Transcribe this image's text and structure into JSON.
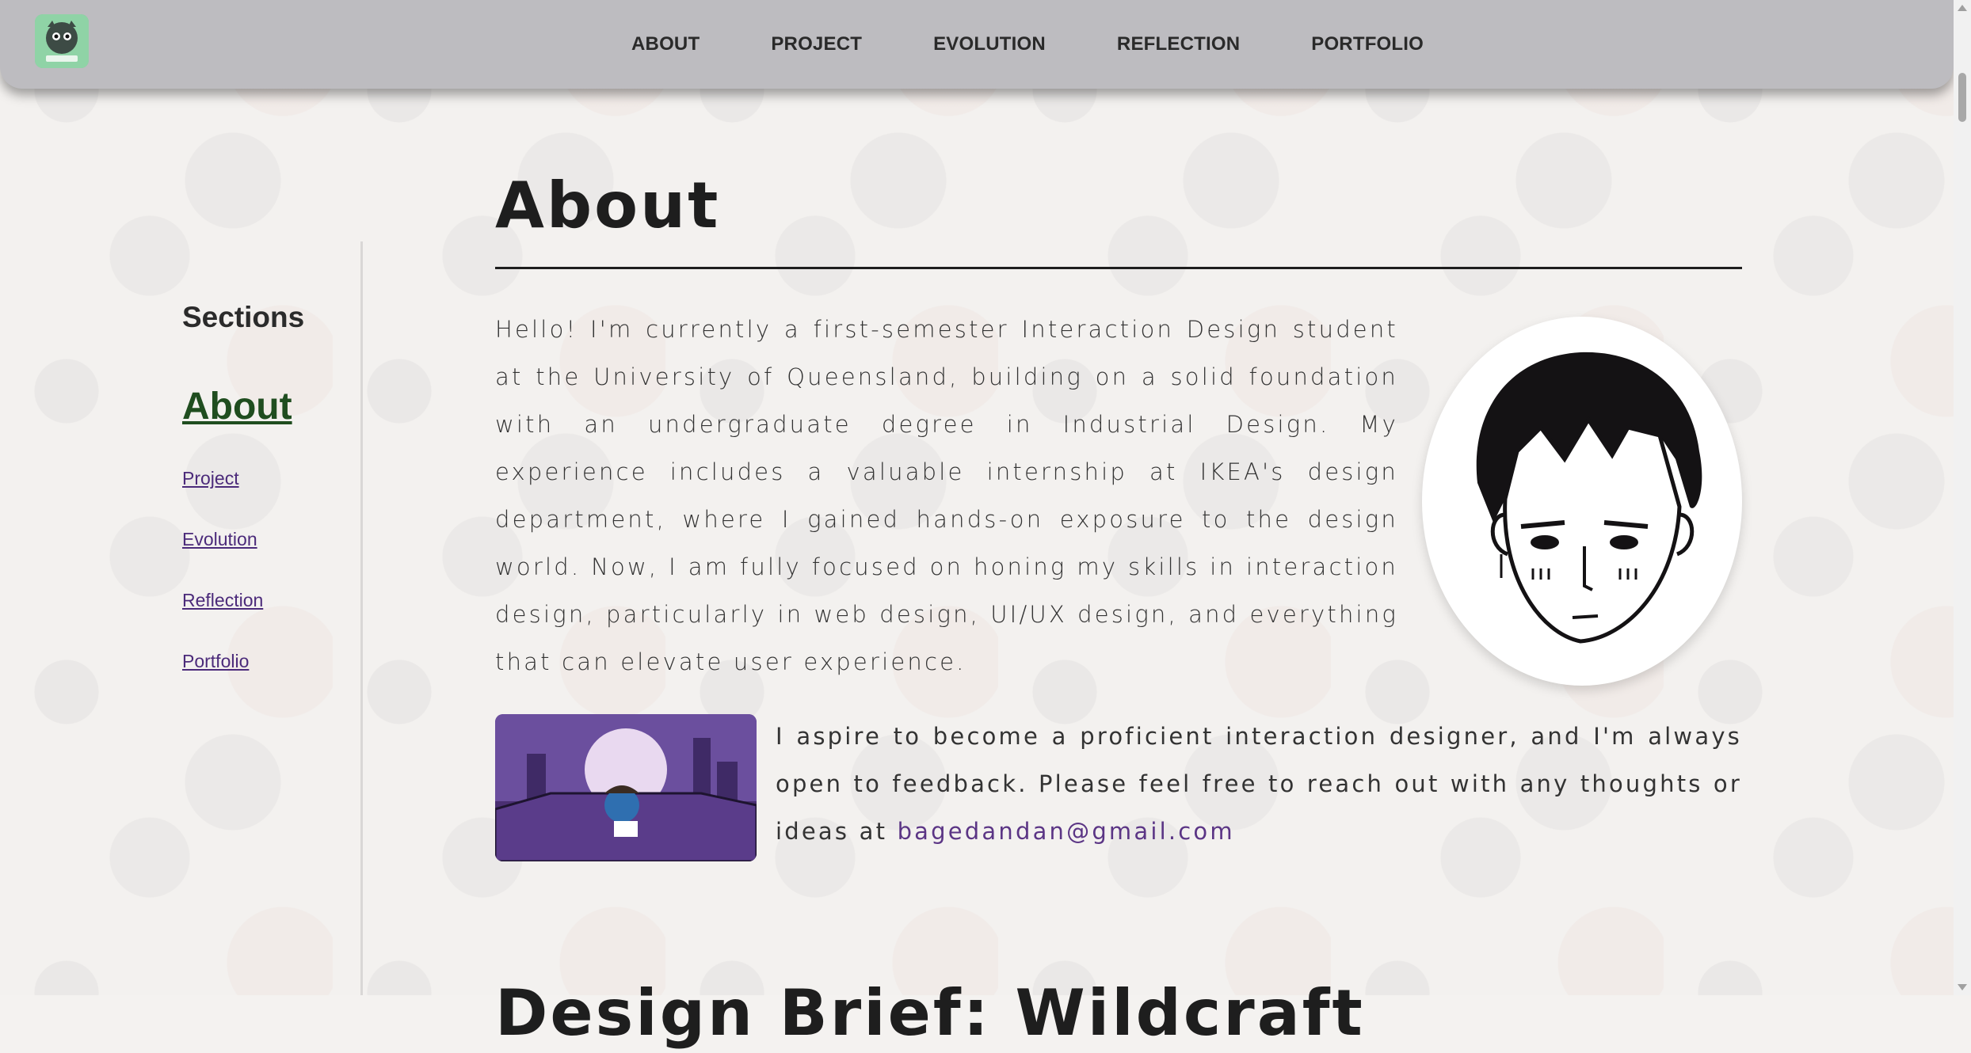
{
  "nav": {
    "items": [
      "ABOUT",
      "PROJECT",
      "EVOLUTION",
      "REFLECTION",
      "PORTFOLIO"
    ]
  },
  "sidebar": {
    "title": "Sections",
    "active": "About",
    "links": [
      "Project",
      "Evolution",
      "Reflection",
      "Portfolio"
    ]
  },
  "main": {
    "title": "About",
    "intro": "Hello! I'm currently a first-semester Interaction Design student at the University of Queensland, building on a solid foundation with an undergraduate degree in Industrial Design. My experience includes a valuable internship at IKEA's design department, where I gained hands-on exposure to the design world. Now, I am fully focused on honing my skills in interaction design, particularly in web design, UI/UX design, and everything that can elevate user experience.",
    "contact_text": "I aspire to become a proficient interaction designer, and I'm always open to feedback. Please feel free to reach out with any thoughts or ideas at ",
    "email": "bagedandan@gmail.com",
    "next_heading": "Design Brief: Wildcraft"
  },
  "colors": {
    "header_bg": "#bdbcc0",
    "active_link": "#1f4d1f",
    "link": "#4b2a7a",
    "email": "#5b3585"
  },
  "icons": [
    "logo-icon",
    "avatar-illustration",
    "car-thumbnail"
  ]
}
